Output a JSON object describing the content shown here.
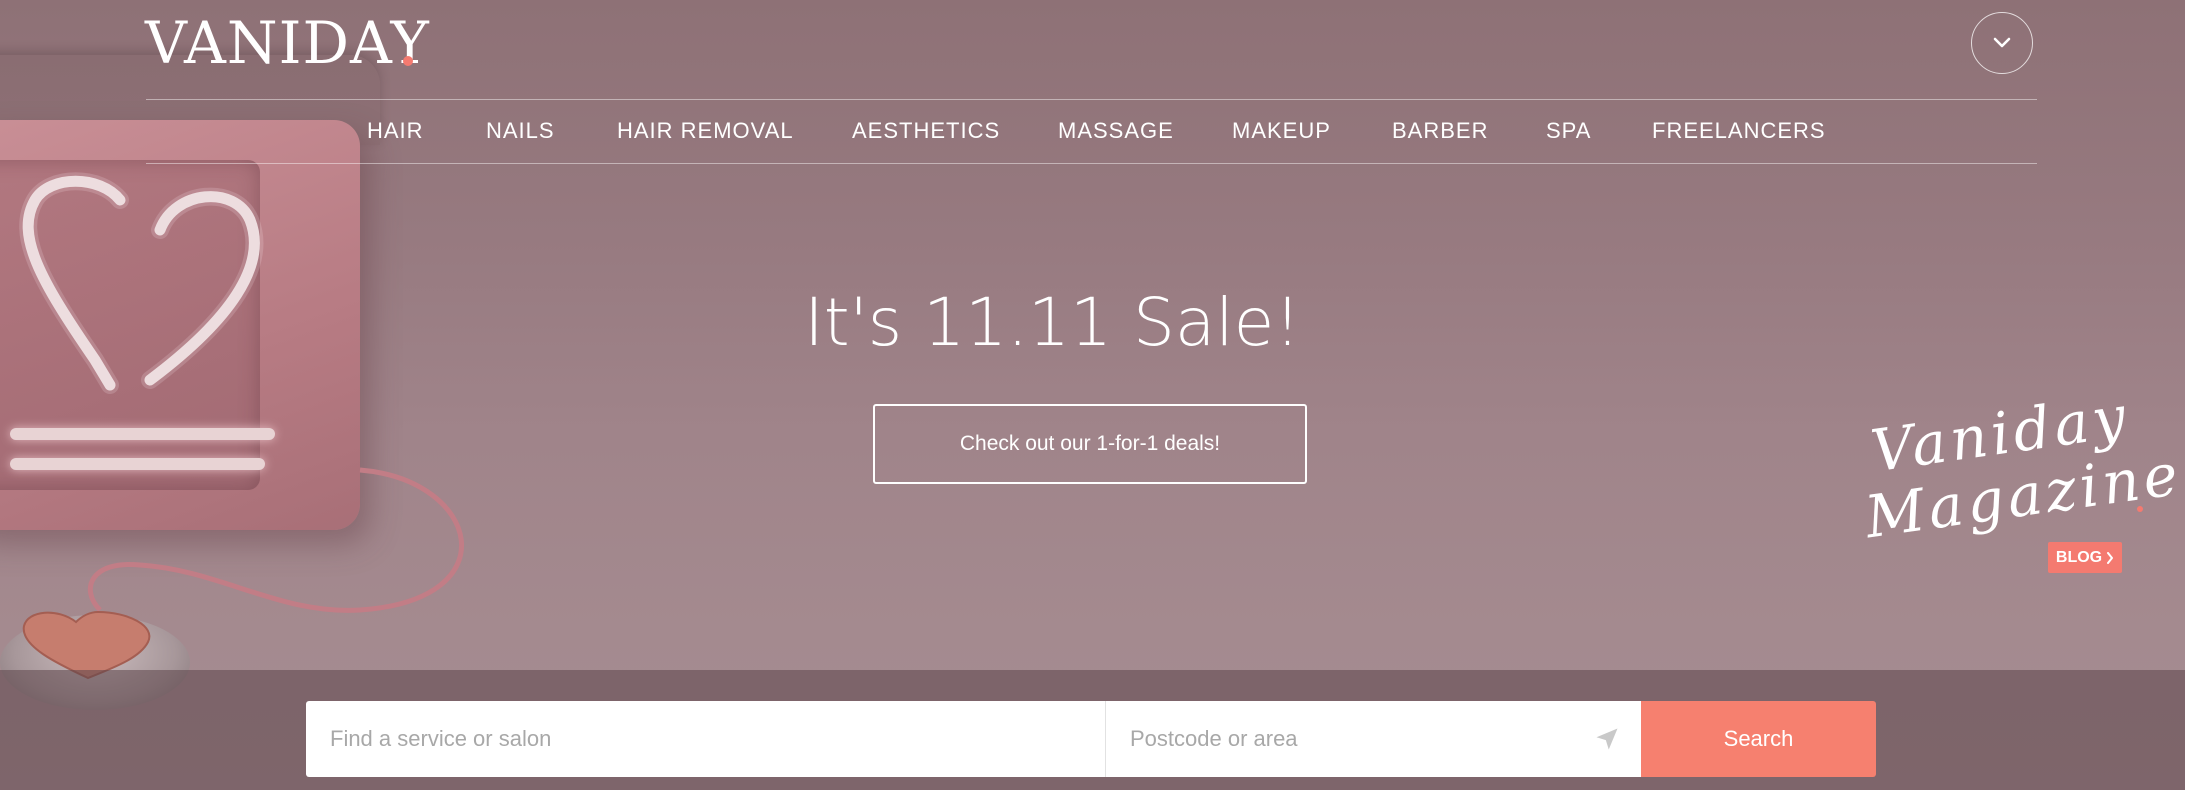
{
  "header": {
    "logo_text": "VANIDAY",
    "menu_toggle_icon": "chevron-down-icon",
    "accent_color": "#f47a70"
  },
  "nav": {
    "items": [
      {
        "label": "HAIR"
      },
      {
        "label": "NAILS"
      },
      {
        "label": "HAIR REMOVAL"
      },
      {
        "label": "AESTHETICS"
      },
      {
        "label": "MASSAGE"
      },
      {
        "label": "MAKEUP"
      },
      {
        "label": "BARBER"
      },
      {
        "label": "SPA"
      },
      {
        "label": "FREELANCERS"
      }
    ]
  },
  "hero": {
    "title": "It's 11.11 Sale!",
    "cta_label": "Check out our 1-for-1 deals!"
  },
  "magazine": {
    "line1": "Vaniday",
    "line2": "Magazine",
    "tag_label": "BLOG",
    "tag_icon": "chevron-right-icon"
  },
  "search": {
    "service_placeholder": "Find a service or salon",
    "service_value": "",
    "location_placeholder": "Postcode or area",
    "location_value": "",
    "location_icon": "location-arrow-icon",
    "button_label": "Search",
    "button_color": "#f6806f"
  }
}
